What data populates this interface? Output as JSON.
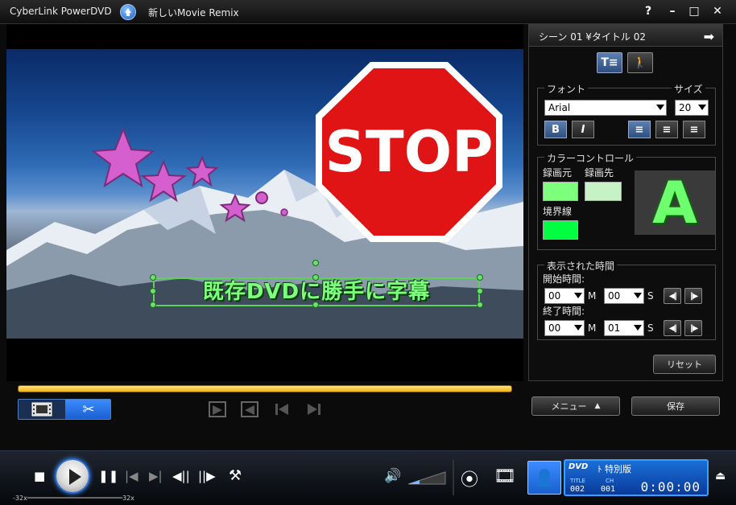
{
  "window": {
    "app_name": "CyberLink PowerDVD",
    "remix_title": "新しいMovie Remix",
    "help": "?",
    "minimize": "–",
    "maximize": "□",
    "close": "✕"
  },
  "video": {
    "stop_text": "STOP",
    "caption": "既存DVDに勝手に字幕"
  },
  "panel": {
    "header": "シーン 01 ¥タイトル 02",
    "font_group": "フォント",
    "size_label": "サイズ",
    "font_value": "Arial",
    "size_value": "20",
    "bold": "B",
    "italic": "I",
    "color_group": "カラーコントロール",
    "rec_from": "録画元",
    "rec_to": "録画先",
    "border": "境界線",
    "preview_letter": "A",
    "colors": {
      "rec_from": "#7dff7d",
      "rec_to": "#c6f2c6",
      "border": "#00ff40"
    },
    "time_group": "表示された時間",
    "start_label": "開始時間:",
    "end_label": "終了時間:",
    "start_min": "00",
    "start_sec": "00",
    "end_min": "00",
    "end_sec": "01",
    "unit_m": "M",
    "unit_s": "S",
    "reset": "リセット"
  },
  "buttons": {
    "menu": "メニュー",
    "save": "保存"
  },
  "player": {
    "speed_min": "-32x",
    "speed_max": "32x",
    "disc_title": "ﾄ 特別版",
    "title_label": "TITLE",
    "ch_label": "CH",
    "title_num": "002",
    "ch_num": "001",
    "time": "0:00:00"
  }
}
